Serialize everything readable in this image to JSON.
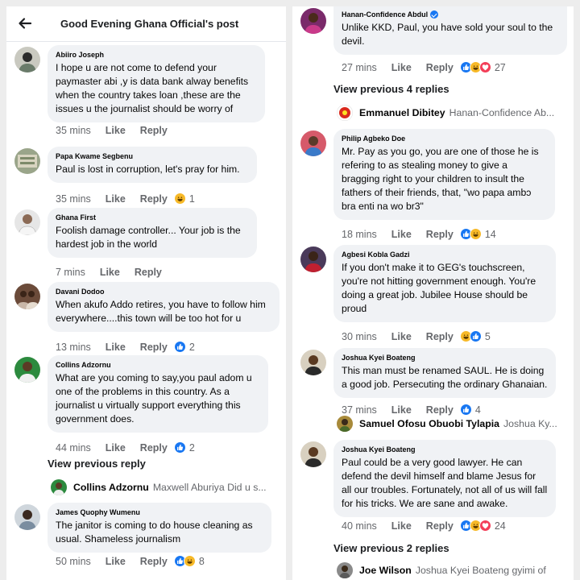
{
  "left": {
    "header": {
      "title": "Good Evening Ghana Official's post"
    },
    "comments": [
      {
        "name": "Abiiro Joseph",
        "text": "I hope u are not come to defend your paymaster abi ,y is data bank alway benefits when the country takes loan ,these are the issues u the journalist should be worry of",
        "time": "35 mins",
        "like": "Like",
        "reply": "Reply",
        "count": ""
      },
      {
        "name": "Papa Kwame Segbenu",
        "text": "Paul is lost in corruption, let's pray for him.",
        "time": "35 mins",
        "like": "Like",
        "reply": "Reply",
        "count": "1"
      },
      {
        "name": "Ghana First",
        "text": "Foolish damage controller... Your job is the hardest job in the world",
        "time": "7 mins",
        "like": "Like",
        "reply": "Reply",
        "count": ""
      },
      {
        "name": "Davani Dodoo",
        "text": "When akufo Addo retires, you have to follow him everywhere....this town will be too hot for u",
        "time": "13 mins",
        "like": "Like",
        "reply": "Reply",
        "count": "2"
      },
      {
        "name": "Collins Adzornu",
        "text": "What are you coming to say,you paul adom u one of the problems in this country. As a journalist u virtually support everything this government does.",
        "time": "44 mins",
        "like": "Like",
        "reply": "Reply",
        "count": "2"
      },
      {
        "name": "James Quophy Wumenu",
        "text": "The janitor is coming to do house cleaning as usual. Shameless journalism",
        "time": "50 mins",
        "like": "Like",
        "reply": "Reply",
        "count": "8"
      }
    ],
    "view_previous": "View previous reply",
    "reply_preview": {
      "name": "Collins Adzornu",
      "text": "Maxwell Aburiya Did u s..."
    }
  },
  "right": {
    "comments": [
      {
        "name": "Hanan-Confidence Abdul",
        "text": "Unlike KKD, Paul, you have sold your soul to the devil.",
        "time": "27 mins",
        "like": "Like",
        "reply": "Reply",
        "count": "27"
      },
      {
        "name": "Philip Agbeko Doe",
        "text": "Mr. Pay as you go, you are one of those he is refering to as stealing money to give a bragging right to your children to insult the fathers of their friends, that,  \"wo papa ambɔ bra enti na wo br3\"",
        "time": "18 mins",
        "like": "Like",
        "reply": "Reply",
        "count": "14"
      },
      {
        "name": "Agbesi Kobla Gadzi",
        "text": "If you don't make it to GEG's touchscreen, you're not hitting government enough. You're doing a great job. Jubilee House should be proud",
        "time": "30 mins",
        "like": "Like",
        "reply": "Reply",
        "count": "5"
      },
      {
        "name": "Joshua Kyei Boateng",
        "text": "This man must be renamed SAUL. He is doing a good job. Persecuting the ordinary Ghanaian.",
        "time": "37 mins",
        "like": "Like",
        "reply": "Reply",
        "count": "4"
      },
      {
        "name": "Joshua Kyei Boateng",
        "text": "Paul could be a very good lawyer. He can defend the devil himself and blame Jesus for all our troubles. Fortunately, not all of us will fall for his tricks. We are sane and awake.",
        "time": "40 mins",
        "like": "Like",
        "reply": "Reply",
        "count": "24"
      }
    ],
    "view_previous_1": "View previous 4 replies",
    "reply_preview_1": {
      "name": "Emmanuel Dibitey",
      "text": "Hanan-Confidence Ab..."
    },
    "reply_preview_2": {
      "name": "Samuel Ofosu Obuobi Tylapia",
      "text": "Joshua Ky..."
    },
    "view_previous_2": "View previous 2 replies",
    "reply_preview_3": {
      "name": "Joe Wilson",
      "text": "Joshua Kyei Boateng gyimi of"
    }
  },
  "colors": {
    "like_blue": "#1877f2",
    "haha_yellow": "#f7b928",
    "love_red": "#f33e58",
    "bubble": "#f0f2f5",
    "meta_gray": "#65676b"
  },
  "icons": {
    "back": "back-arrow-icon",
    "like": "like-reaction-icon",
    "haha": "haha-reaction-icon",
    "love": "love-reaction-icon",
    "verified": "verified-badge-icon"
  }
}
